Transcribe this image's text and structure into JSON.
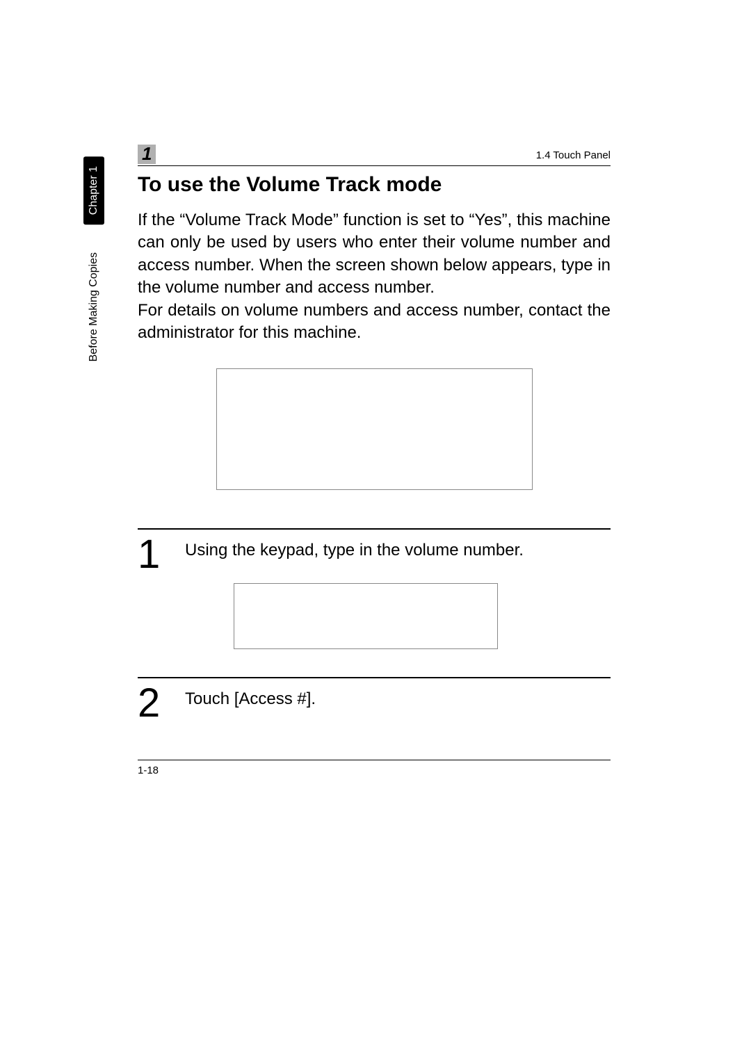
{
  "side": {
    "chapter_label": "Chapter 1",
    "section_label": "Before Making Copies"
  },
  "header": {
    "chapter_number": "1",
    "breadcrumb": "1.4 Touch Panel"
  },
  "heading": "To use the Volume Track mode",
  "intro_paragraph": "If the “Volume Track Mode” function is set to “Yes”, this machine can only be used by users who enter their volume number and access number. When the screen shown below appears, type in the volume number and access number.\nFor details on volume numbers and access number, contact the administrator for this machine.",
  "steps": [
    {
      "num": "1",
      "text": "Using the keypad, type in the volume number."
    },
    {
      "num": "2",
      "text": "Touch [Access #]."
    }
  ],
  "footer": {
    "page_number": "1-18"
  }
}
